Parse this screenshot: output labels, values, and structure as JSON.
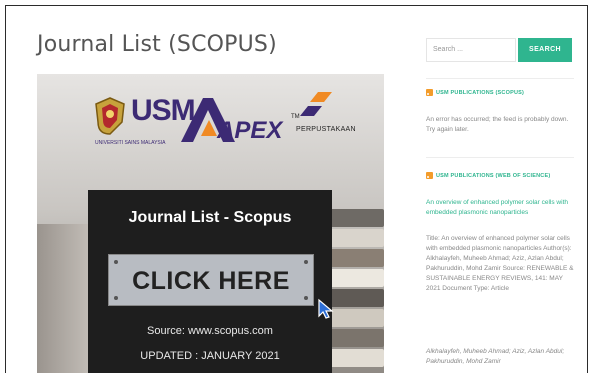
{
  "page": {
    "title": "Journal List (SCOPUS)"
  },
  "banner": {
    "usm_text": "USM",
    "usm_subtitle": "UNIVERSITI SAINS MALAYSIA",
    "apex_text": "APEX",
    "apex_tm": "TM",
    "library_text": "PERPUSTAKAAN",
    "heading": "Journal List - Scopus",
    "button_label": "CLICK HERE",
    "source": "Source: www.scopus.com",
    "updated": "UPDATED : JANUARY 2021"
  },
  "search": {
    "placeholder": "Search ...",
    "button_label": "SEARCH"
  },
  "sidebar": {
    "feed1_title": "USM PUBLICATIONS (SCOPUS)",
    "feed1_error": "An error has occurred; the feed is probably down. Try again later.",
    "feed2_title": "USM PUBLICATIONS (WEB OF SCIENCE)",
    "feed2_link": "An overview of enhanced polymer solar cells with embedded plasmonic nanoparticles",
    "feed2_desc": "Title: An overview of enhanced polymer solar cells with embedded plasmonic nanoparticles Author(s): Alkhalayfeh, Muheeb Ahmad; Aziz, Azlan Abdul; Pakhuruddin, Mohd Zamir Source: RENEWABLE & SUSTAINABLE ENERGY REVIEWS, 141: MAY 2021 Document Type: Article",
    "feed2_authors": "Alkhalayfeh, Muheeb Ahmad; Aziz, Azlan Abdul; Pakhuruddin, Mohd Zamir"
  },
  "colors": {
    "accent": "#2fb58f",
    "rss": "#f39c2b",
    "title": "#555555",
    "usm_purple": "#3c2a74"
  }
}
